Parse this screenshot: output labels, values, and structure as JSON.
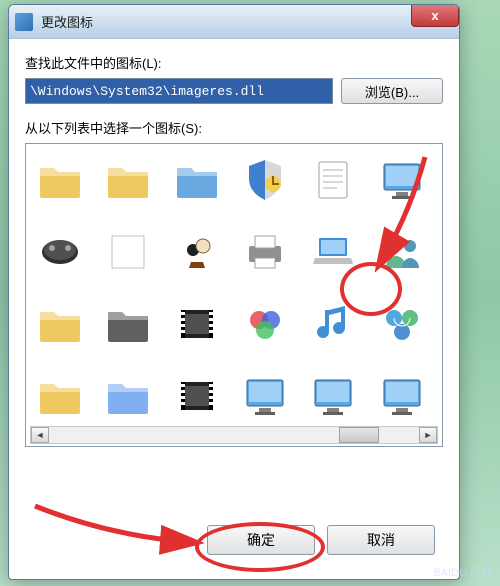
{
  "titlebar": {
    "title": "更改图标",
    "close_label": "x"
  },
  "labels": {
    "find_in_file": "查找此文件中的图标(L):",
    "select_from_list": "从以下列表中选择一个图标(S):"
  },
  "path_field": {
    "value": "\\Windows\\System32\\imageres.dll"
  },
  "buttons": {
    "browse": "浏览(B)...",
    "ok": "确定",
    "cancel": "取消"
  },
  "icons": [
    {
      "name": "folder-documents-icon",
      "kind": "folder",
      "tint": "#f0c860"
    },
    {
      "name": "folder-music-icon",
      "kind": "folder",
      "tint": "#f0c860"
    },
    {
      "name": "folder-blue-icon",
      "kind": "folder",
      "tint": "#6aa8e0"
    },
    {
      "name": "shield-chart-icon",
      "kind": "shield"
    },
    {
      "name": "document-icon",
      "kind": "doc"
    },
    {
      "name": "monitor-blue-icon",
      "kind": "monitor"
    },
    {
      "name": "remote-control-icon",
      "kind": "device"
    },
    {
      "name": "blank-page-icon",
      "kind": "blank"
    },
    {
      "name": "chess-pieces-icon",
      "kind": "chess"
    },
    {
      "name": "printer-icon",
      "kind": "printer"
    },
    {
      "name": "laptop-icon",
      "kind": "laptop"
    },
    {
      "name": "users-people-icon",
      "kind": "people"
    },
    {
      "name": "folder-icon",
      "kind": "folder",
      "tint": "#f0c860"
    },
    {
      "name": "folder-black-icon",
      "kind": "folder",
      "tint": "#606060"
    },
    {
      "name": "film-strip-icon",
      "kind": "film"
    },
    {
      "name": "color-settings-icon",
      "kind": "colors"
    },
    {
      "name": "music-note-icon",
      "kind": "music"
    },
    {
      "name": "network-globe-icon",
      "kind": "globe"
    },
    {
      "name": "folder-down-icon",
      "kind": "folder",
      "tint": "#f0c860"
    },
    {
      "name": "folder-blue2-icon",
      "kind": "folder",
      "tint": "#80b0f0"
    },
    {
      "name": "film-strip2-icon",
      "kind": "film"
    },
    {
      "name": "monitor-film-icon",
      "kind": "monitor"
    },
    {
      "name": "monitor-film2-icon",
      "kind": "monitor"
    },
    {
      "name": "monitor-icon",
      "kind": "monitor"
    }
  ],
  "annotations": {
    "circle_people": true,
    "circle_ok": true,
    "arrow_to_people": true,
    "arrow_to_ok": true
  },
  "colors": {
    "highlight": "#e03030",
    "sel_bg": "#3060a8"
  },
  "watermark": "BAIDU 经验"
}
